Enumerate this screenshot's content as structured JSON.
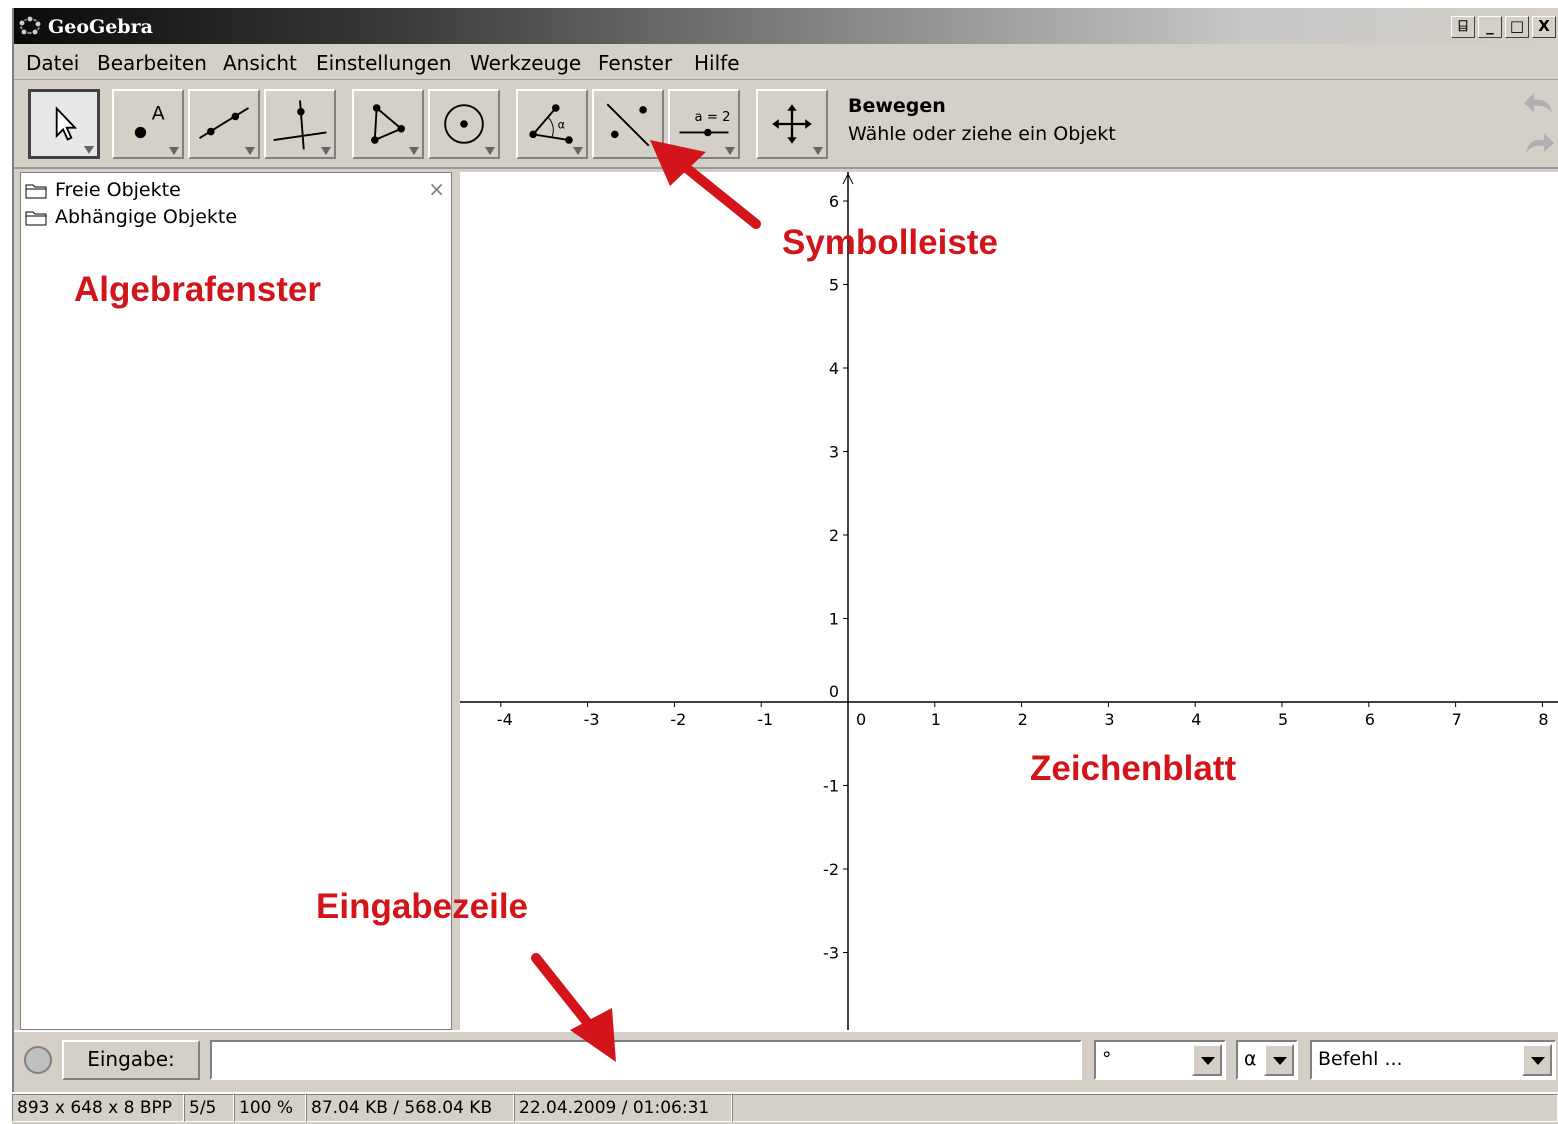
{
  "window": {
    "title": "GeoGebra",
    "controls": [
      "⌸",
      "_",
      "□",
      "X"
    ]
  },
  "menu": [
    "Datei",
    "Bearbeiten",
    "Ansicht",
    "Einstellungen",
    "Werkzeuge",
    "Fenster",
    "Hilfe"
  ],
  "toolbar": {
    "active_tool_name": "Bewegen",
    "active_tool_help": "Wähle oder ziehe ein Objekt",
    "tools": [
      {
        "icon": "move-pointer-icon"
      },
      {
        "icon": "new-point-icon",
        "label": "A"
      },
      {
        "icon": "line-through-two-points-icon"
      },
      {
        "icon": "perpendicular-line-icon"
      },
      {
        "icon": "polygon-icon"
      },
      {
        "icon": "circle-with-center-icon"
      },
      {
        "icon": "angle-icon",
        "label": "α"
      },
      {
        "icon": "reflect-about-line-icon"
      },
      {
        "icon": "slider-icon",
        "label": "a = 2"
      },
      {
        "icon": "move-graphics-view-icon"
      }
    ]
  },
  "algebra": {
    "items": [
      "Freie Objekte",
      "Abhängige Objekte"
    ],
    "close": "×"
  },
  "graphics": {
    "x_ticks": [
      "-4",
      "-3",
      "-2",
      "-1",
      "0",
      "1",
      "2",
      "3",
      "4",
      "5",
      "6",
      "7",
      "8"
    ],
    "y_ticks": [
      "6",
      "5",
      "4",
      "3",
      "2",
      "1",
      "0",
      "-1",
      "-2",
      "-3"
    ]
  },
  "input": {
    "button_label": "Eingabe:",
    "value": "",
    "symbol_combo": "°",
    "greek_combo": "α",
    "command_combo": "Befehl ..."
  },
  "status": [
    "893 x 648 x 8 BPP",
    "5/5",
    "100 %",
    "87.04 KB / 568.04 KB",
    "22.04.2009 / 01:06:31"
  ],
  "annotations": {
    "algebra": "Algebrafenster",
    "toolbar": "Symbolleiste",
    "graphics": "Zeichenblatt",
    "input": "Eingabezeile"
  },
  "colors": {
    "annotation": "#d4141b",
    "window_bg": "#d4d0c8"
  }
}
